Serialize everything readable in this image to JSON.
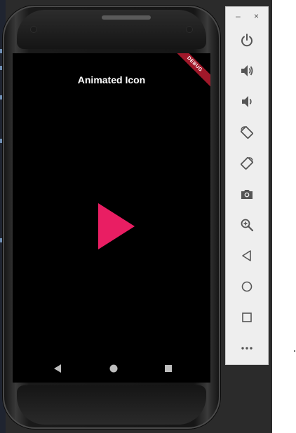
{
  "app": {
    "title": "Animated Icon",
    "debug_banner": "DEBUG",
    "icon_color": "#e91e63"
  },
  "navigation": [
    "back-icon",
    "home-icon",
    "overview-icon"
  ],
  "toolbar": {
    "minimize": "–",
    "close": "×",
    "buttons": [
      "power-icon",
      "volume-up-icon",
      "volume-down-icon",
      "rotate-left-icon",
      "rotate-right-icon",
      "camera-icon",
      "zoom-icon",
      "back-icon",
      "home-icon",
      "overview-icon",
      "more-icon"
    ]
  }
}
